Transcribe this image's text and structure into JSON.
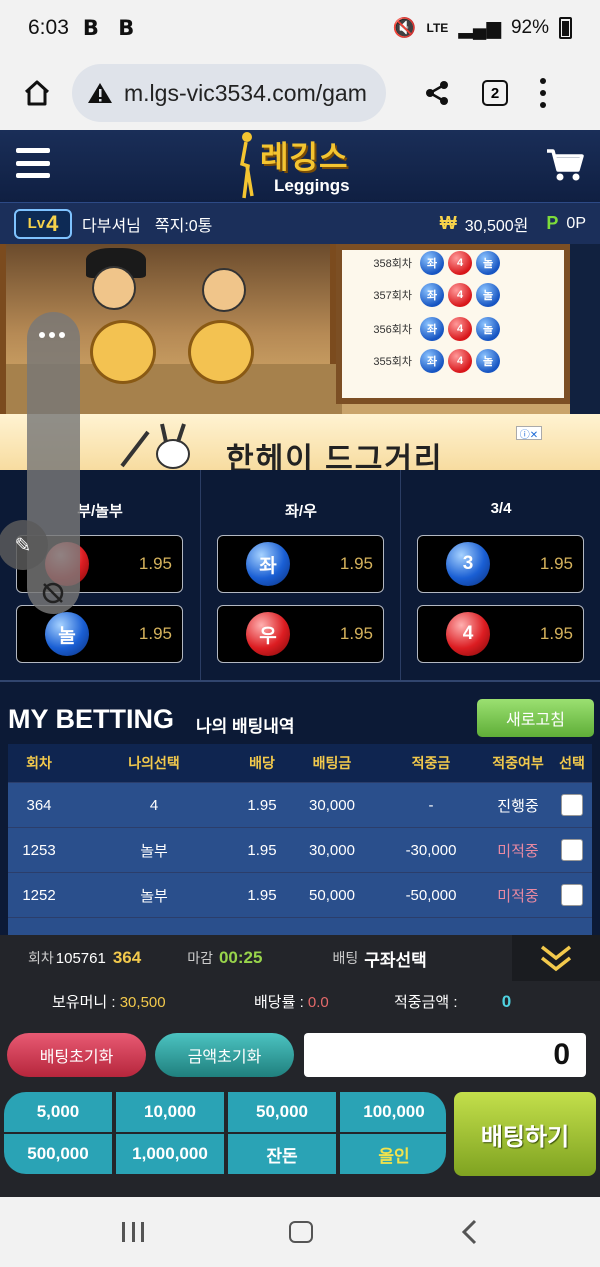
{
  "status": {
    "time": "6:03",
    "notif_icons": "B B",
    "net": "LTE",
    "battery": "92%"
  },
  "browser": {
    "url": "m.lgs-vic3534.com/gam",
    "tab_count": "2"
  },
  "site": {
    "logo_kr": "레깅스",
    "logo_en": "Leggings"
  },
  "user": {
    "level_prefix": "Lv",
    "level": "4",
    "name": "다부셔님",
    "messages": "쪽지:0통",
    "money_icon": "₩",
    "money": "30,500원",
    "point_icon": "P",
    "points": "0P"
  },
  "game": {
    "results": [
      {
        "round": "358회차",
        "side": "좌",
        "num": "4",
        "type": "놀"
      },
      {
        "round": "357회차",
        "side": "좌",
        "num": "4",
        "type": "놀"
      },
      {
        "round": "356회차",
        "side": "좌",
        "num": "4",
        "type": "놀"
      },
      {
        "round": "355회차",
        "side": "좌",
        "num": "4",
        "type": "놀"
      }
    ],
    "ad_text": "한헤이 드그거리",
    "ad_close": "ⓘ✕"
  },
  "odds": {
    "columns": [
      {
        "header": "부/놀부",
        "options": [
          {
            "label": "",
            "color": "red",
            "odd": "1.95"
          },
          {
            "label": "놀",
            "color": "blue",
            "odd": "1.95"
          }
        ]
      },
      {
        "header": "좌/우",
        "options": [
          {
            "label": "좌",
            "color": "blue",
            "odd": "1.95"
          },
          {
            "label": "우",
            "color": "red",
            "odd": "1.95"
          }
        ]
      },
      {
        "header": "3/4",
        "options": [
          {
            "label": "3",
            "color": "blue",
            "odd": "1.95"
          },
          {
            "label": "4",
            "color": "red",
            "odd": "1.95"
          }
        ]
      }
    ]
  },
  "mybet": {
    "title": "MY BETTING",
    "subtitle": "나의 배팅내역",
    "refresh": "새로고침",
    "headers": [
      "회차",
      "나의선택",
      "배당",
      "배팅금",
      "적중금",
      "적중여부",
      "선택"
    ],
    "rows": [
      {
        "round": "364",
        "pick": "4",
        "odd": "1.95",
        "amount": "30,000",
        "win": "-",
        "status": "진행중",
        "state": "pending"
      },
      {
        "round": "1253",
        "pick": "놀부",
        "odd": "1.95",
        "amount": "30,000",
        "win": "-30,000",
        "status": "미적중",
        "state": "miss"
      },
      {
        "round": "1252",
        "pick": "놀부",
        "odd": "1.95",
        "amount": "50,000",
        "win": "-50,000",
        "status": "미적중",
        "state": "miss"
      }
    ]
  },
  "panel": {
    "round_label": "회차",
    "round_id": "105761",
    "round_no": "364",
    "deadline_label": "마감",
    "deadline": "00:25",
    "bet_label": "배팅",
    "bet_choice": "구좌선택",
    "balance_label": "보유머니 :",
    "balance": "30,500",
    "rate_label": "배당률 :",
    "rate": "0.0",
    "hit_label": "적중금액 :",
    "hit": "0",
    "reset_bet": "배팅초기화",
    "reset_amount": "금액초기화",
    "amount": "0",
    "chips": [
      "5,000",
      "10,000",
      "50,000",
      "100,000",
      "500,000",
      "1,000,000",
      "잔돈",
      "올인"
    ],
    "bet_now": "배팅하기"
  }
}
